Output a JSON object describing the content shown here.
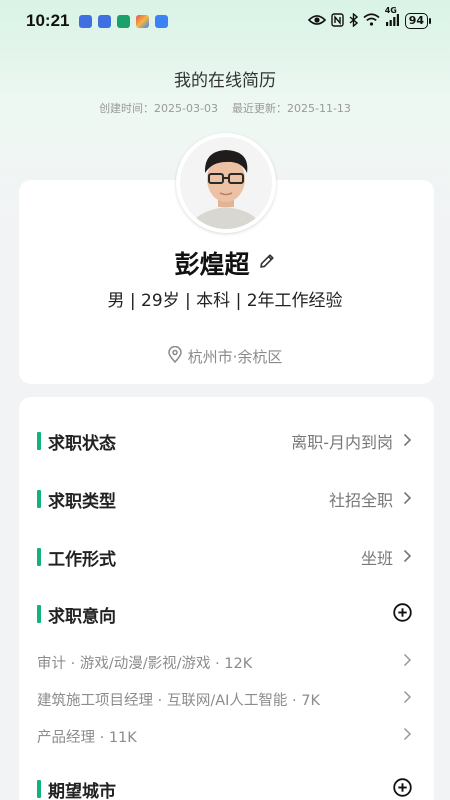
{
  "status_bar": {
    "time": "10:21",
    "network": "4G",
    "battery": "94",
    "app_icons": [
      "#3f6fe0",
      "#3f6fe0",
      "#1aa06a",
      "#e94d4d",
      "#3b82f6"
    ]
  },
  "header": {
    "title": "我的在线简历",
    "created": "创建时间：2025-03-03",
    "updated": "最近更新：2025-11-13"
  },
  "profile": {
    "name": "彭煌超",
    "meta": "男 | 29岁 | 本科 | 2年工作经验",
    "location": "杭州市·余杭区"
  },
  "sections": {
    "job_status": {
      "title": "求职状态",
      "value": "离职-月内到岗"
    },
    "job_type": {
      "title": "求职类型",
      "value": "社招全职"
    },
    "work_form": {
      "title": "工作形式",
      "value": "坐班"
    },
    "job_intent": {
      "title": "求职意向",
      "items": [
        "审计 · 游戏/动漫/影视/游戏 · 12K",
        "建筑施工项目经理 · 互联网/AI人工智能 · 7K",
        "产品经理 · 11K"
      ]
    },
    "expected_city": {
      "title": "期望城市"
    }
  },
  "colors": {
    "accent": "#12b37a",
    "background": "#f2f3f5"
  }
}
